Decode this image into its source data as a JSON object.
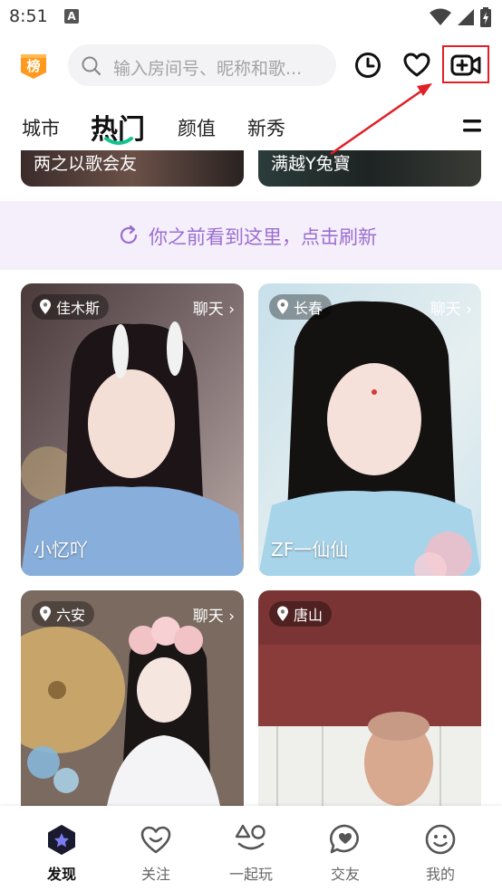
{
  "status_bar": {
    "time": "8:51",
    "notification_glyph": "A"
  },
  "top_bar": {
    "rank_badge_label": "榜",
    "search_placeholder": "输入房间号、昵称和歌...",
    "icons": [
      "clock-icon",
      "heart-icon",
      "live-video-add-icon"
    ]
  },
  "tabs": [
    {
      "label": "城市",
      "active": false
    },
    {
      "label": "热门",
      "active": true
    },
    {
      "label": "颜值",
      "active": false
    },
    {
      "label": "新秀",
      "active": false
    }
  ],
  "partial_cards": [
    {
      "label": "两之以歌会友"
    },
    {
      "label": "满越Y兔寶"
    }
  ],
  "refresh_banner": {
    "text": "你之前看到这里，点击刷新"
  },
  "cards": [
    {
      "location": "佳木斯",
      "chat": "聊天 ›",
      "name": "小忆吖"
    },
    {
      "location": "长春",
      "chat": "聊天 ›",
      "name": "ZF一仙仙"
    },
    {
      "location": "六安",
      "chat": "聊天 ›",
      "name": ""
    },
    {
      "location": "唐山",
      "chat": "",
      "name": ""
    }
  ],
  "bottom_nav": [
    {
      "label": "发现",
      "icon": "discover-icon",
      "active": true
    },
    {
      "label": "关注",
      "icon": "follow-heart-icon",
      "active": false
    },
    {
      "label": "一起玩",
      "icon": "play-together-icon",
      "active": false
    },
    {
      "label": "交友",
      "icon": "chat-bubble-heart-icon",
      "active": false
    },
    {
      "label": "我的",
      "icon": "smiley-icon",
      "active": false
    }
  ],
  "colors": {
    "accent_green": "#12c48c",
    "refresh_purple": "#9a6fd0",
    "badge_orange": "#ff9a1f",
    "highlight_red": "#e21f26"
  }
}
